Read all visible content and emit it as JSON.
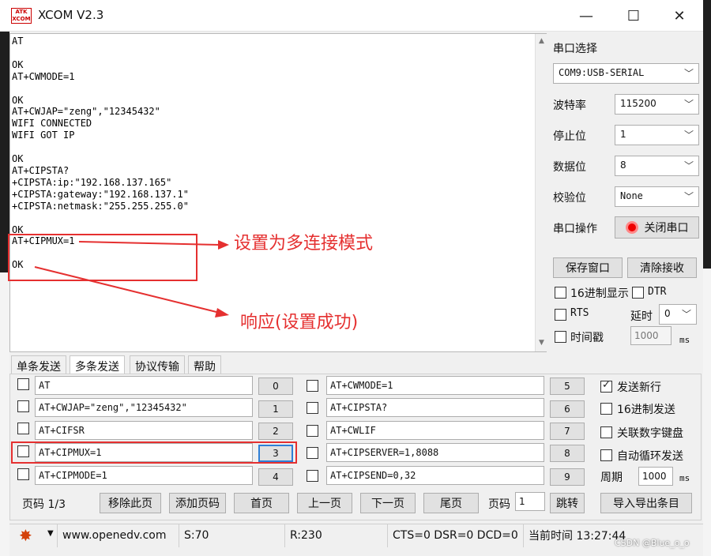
{
  "window": {
    "logo": "ATK\nXCOM",
    "title": "XCOM V2.3",
    "minimize": "—",
    "maximize": "☐",
    "close": "✕"
  },
  "receive_text": "AT\n\nOK\nAT+CWMODE=1\n\nOK\nAT+CWJAP=\"zeng\",\"12345432\"\nWIFI CONNECTED\nWIFI GOT IP\n\nOK\nAT+CIPSTA?\n+CIPSTA:ip:\"192.168.137.165\"\n+CIPSTA:gateway:\"192.168.137.1\"\n+CIPSTA:netmask:\"255.255.255.0\"\n\nOK\nAT+CIPMUX=1\n\nOK",
  "annotations": {
    "multi_conn": "设置为多连接模式",
    "response": "响应(设置成功)"
  },
  "serial": {
    "port_label": "串口选择",
    "port_value": "COM9:USB-SERIAL",
    "baud_label": "波特率",
    "baud_value": "115200",
    "stopbits_label": "停止位",
    "stopbits_value": "1",
    "databits_label": "数据位",
    "databits_value": "8",
    "parity_label": "校验位",
    "parity_value": "None",
    "op_label": "串口操作",
    "close_port": "关闭串口",
    "save_window": "保存窗口",
    "clear_recv": "清除接收",
    "hex_display": "16进制显示",
    "dtr": "DTR",
    "rts": "RTS",
    "delay_label": "延时",
    "delay_value": "0",
    "timestamp": "时间戳",
    "timestamp_value": "1000",
    "ms": "ms"
  },
  "tabs": [
    "单条发送",
    "多条发送",
    "协议传输",
    "帮助"
  ],
  "commands_left": [
    {
      "text": "AT",
      "num": "0"
    },
    {
      "text": "AT+CWJAP=\"zeng\",\"12345432\"",
      "num": "1"
    },
    {
      "text": "AT+CIFSR",
      "num": "2"
    },
    {
      "text": "AT+CIPMUX=1",
      "num": "3"
    },
    {
      "text": "AT+CIPMODE=1",
      "num": "4"
    }
  ],
  "commands_right": [
    {
      "text": "AT+CWMODE=1",
      "num": "5"
    },
    {
      "text": "AT+CIPSTA?",
      "num": "6"
    },
    {
      "text": "AT+CWLIF",
      "num": "7"
    },
    {
      "text": "AT+CIPSERVER=1,8088",
      "num": "8"
    },
    {
      "text": "AT+CIPSEND=0,32",
      "num": "9"
    }
  ],
  "send_opts": {
    "newline": "发送新行",
    "hex_send": "16进制发送",
    "numpad": "关联数字键盘",
    "auto_loop": "自动循环发送",
    "period_label": "周期",
    "period_value": "1000",
    "ms": "ms"
  },
  "pager": {
    "page_info": "页码 1/3",
    "remove_page": "移除此页",
    "add_page": "添加页码",
    "first": "首页",
    "prev": "上一页",
    "next": "下一页",
    "last": "尾页",
    "page_label": "页码",
    "page_value": "1",
    "jump": "跳转",
    "import_export": "导入导出条目"
  },
  "status": {
    "url": "www.openedv.com",
    "sent": "S:70",
    "recv": "R:230",
    "lines": "CTS=0 DSR=0 DCD=0",
    "time": "当前时间 13:27:44"
  },
  "watermark": "CSDN @Blue_o_o",
  "colors": {
    "annotation": "#e53030",
    "focus": "#2f7fd6"
  }
}
